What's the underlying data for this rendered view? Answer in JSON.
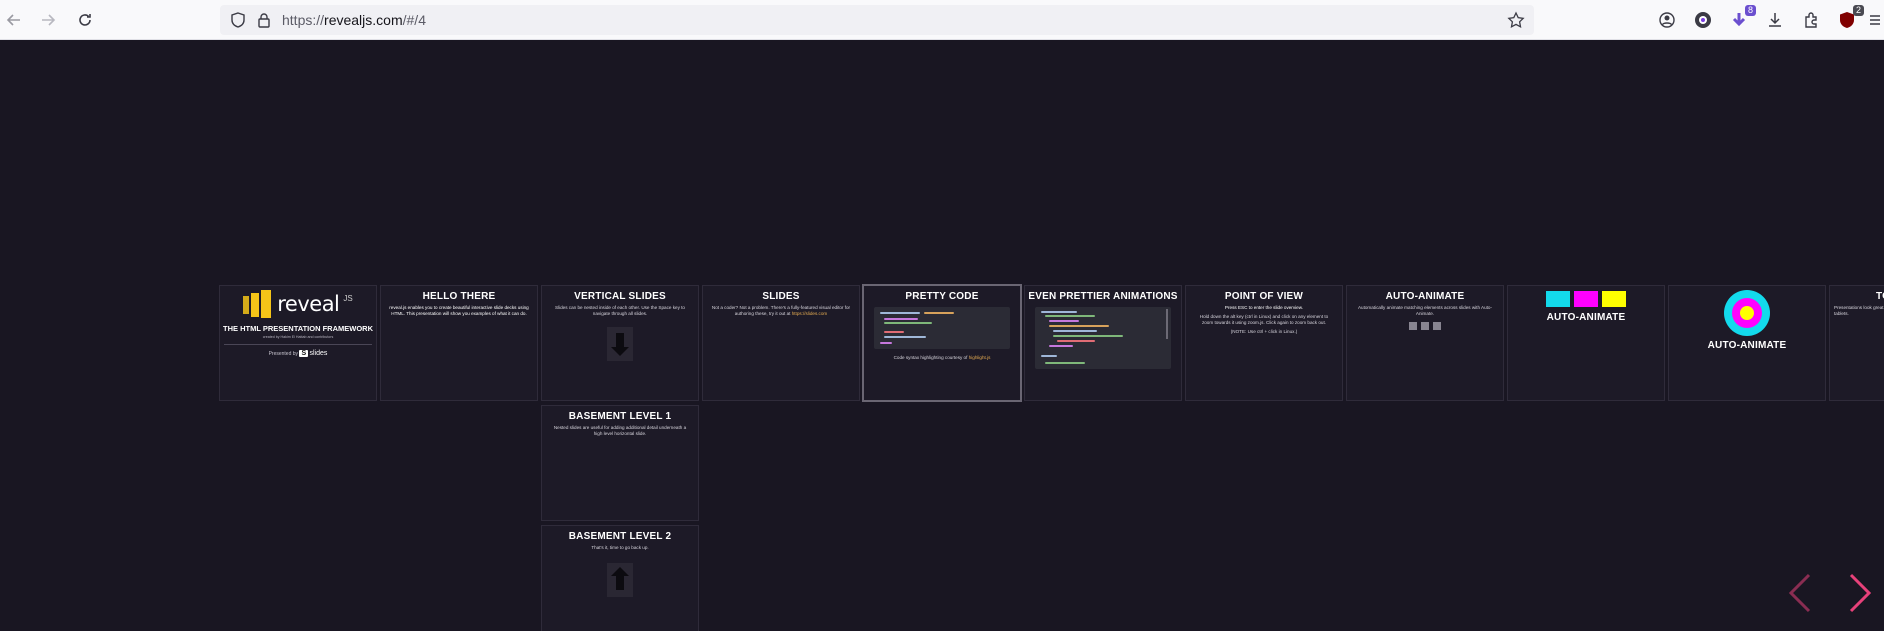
{
  "browser": {
    "url_scheme": "https://",
    "url_host": "revealjs.com",
    "url_path": "/#/4",
    "ext_badge_count": "8",
    "ublock_badge_count": "2"
  },
  "slides": {
    "title_slide": {
      "logo_word": "reveal",
      "logo_suffix": "JS",
      "subtitle": "THE HTML PRESENTATION FRAMEWORK",
      "credit": "created by Hakim El Hattab and contributors",
      "sponsor_prefix": "Presented by",
      "sponsor_logo_mark": "S",
      "sponsor_logo_word": "slides"
    },
    "hello": {
      "title": "HELLO THERE",
      "body": "reveal.js enables you to create beautiful interactive slide decks using HTML. This presentation will show you examples of what it can do."
    },
    "vertical": {
      "title": "VERTICAL SLIDES",
      "body": "Slides can be nested inside of each other. Use the Space key to navigate through all slides."
    },
    "basement1": {
      "title": "BASEMENT LEVEL 1",
      "body": "Nested slides are useful for adding additional detail underneath a high level horizontal slide."
    },
    "basement2": {
      "title": "BASEMENT LEVEL 2",
      "body": "That's it, time to go back up."
    },
    "slides": {
      "title": "SLIDES",
      "body": "Not a coder? Not a problem. There's a fully-featured visual editor for authoring these, try it out at",
      "link": "https://slides.com"
    },
    "pretty_code": {
      "title": "PRETTY CODE",
      "body_prefix": "Code syntax highlighting courtesy of",
      "link": "highlight.js"
    },
    "animations": {
      "title": "EVEN PRETTIER ANIMATIONS"
    },
    "point_of_view": {
      "title": "POINT OF VIEW",
      "body1": "Press ESC to enter the slide overview.",
      "body2": "Hold down the alt key (ctrl in Linux) and click on any element to zoom towards it using zoom.js. Click again to zoom back out.",
      "body3": "(NOTE: Use ctrl + click in Linux.)"
    },
    "auto_animate1": {
      "title": "AUTO-ANIMATE",
      "body": "Automatically animate matching elements across slides with Auto-Animate."
    },
    "auto_animate2": {
      "title": "AUTO-ANIMATE"
    },
    "auto_animate3": {
      "title": "AUTO-ANIMATE"
    },
    "touch": {
      "title": "TOU",
      "body": "Presentations look great on touch devices, like mobile phones and tablets."
    }
  },
  "colors": {
    "background": "#191622",
    "accent": "#e7417a",
    "link": "#e7ad52",
    "logo_yellow": "#f5c518",
    "cyan": "#13daec",
    "magenta": "#ff00ff",
    "yellow": "#ffff00"
  },
  "controls": {
    "prev_icon": "chevron-left-icon",
    "next_icon": "chevron-right-icon"
  }
}
